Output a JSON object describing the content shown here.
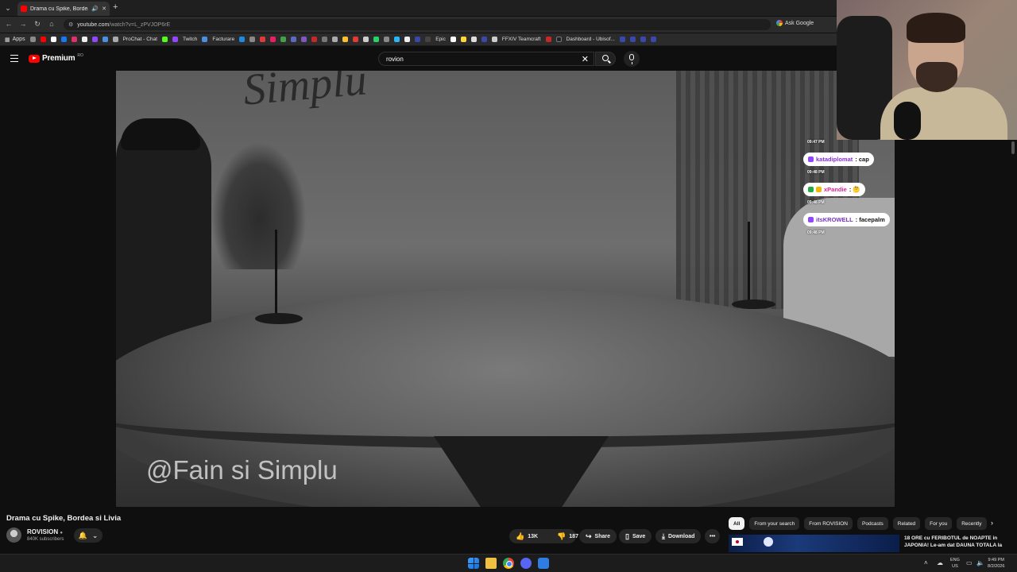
{
  "browser": {
    "tab_title": "Drama cu Spike, Bordea si L",
    "tab_mute_icon": "speaker-icon",
    "url_host": "youtube.com",
    "url_path": "/watch?v=L_zPVJOP6rE",
    "ask_google": "Ask Google",
    "bookmarks": {
      "apps": "Apps",
      "prochat": "ProChat - Chat",
      "twitch": "Twitch",
      "facturare": "Facturare",
      "epic": "Epic",
      "ffxiv": "FFXIV Teamcraft",
      "dashboard": "Dashboard - Ubisof..."
    }
  },
  "youtube": {
    "logo_text": "Premium",
    "logo_region": "RO",
    "search_query": "rovion"
  },
  "video": {
    "watermark": "@Fain si Simplu",
    "wall_text": "Simplu",
    "title": "Drama cu Spike, Bordea si Livia"
  },
  "chat": {
    "times": [
      "09:47 PM",
      "09:48 PM",
      "09:48 PM",
      "09:48 PM"
    ],
    "messages": [
      {
        "user": "katadiplomat",
        "text": ": cap",
        "color": "#8a2be2"
      },
      {
        "user": "xPandie",
        "text": ": 🤔",
        "color": "#e0209a"
      },
      {
        "user": "itsKROWELL",
        "text": ": facepalm",
        "color": "#7a32c8"
      }
    ]
  },
  "channel": {
    "name": "ROVISION",
    "verified_icon": "verified-check-icon",
    "subscribers": "840K subscribers"
  },
  "actions": {
    "likes": "13K",
    "dislikes": "187",
    "share": "Share",
    "save": "Save",
    "download": "Download",
    "more": "•••"
  },
  "chips": [
    "All",
    "From your search",
    "From ROVISION",
    "Podcasts",
    "Related",
    "For you",
    "Recently"
  ],
  "recommended": {
    "title": "18 ORE cu FERIBOTUL de NOAPTE in JAPONIA! Le-am dat DAUNA TOTALA la"
  },
  "taskbar": {
    "lang_top": "ENG",
    "lang_bottom": "US",
    "time": "9:49 PM",
    "date": "8/2/2026"
  }
}
